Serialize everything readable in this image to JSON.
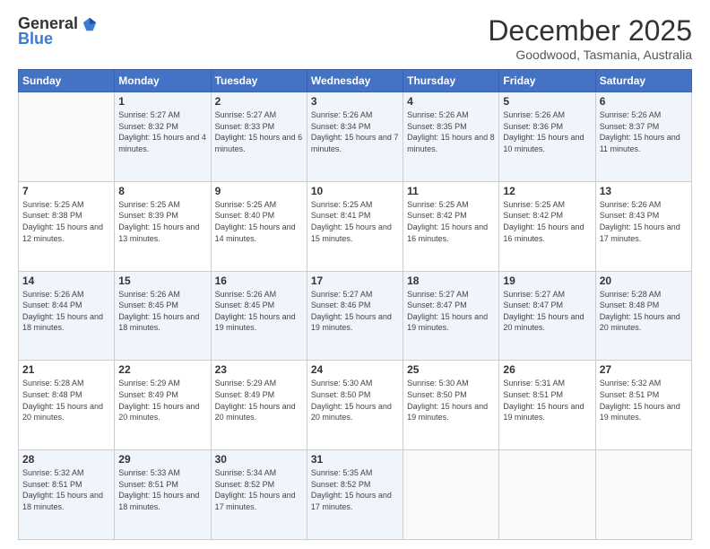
{
  "logo": {
    "general": "General",
    "blue": "Blue"
  },
  "header": {
    "month": "December 2025",
    "location": "Goodwood, Tasmania, Australia"
  },
  "weekdays": [
    "Sunday",
    "Monday",
    "Tuesday",
    "Wednesday",
    "Thursday",
    "Friday",
    "Saturday"
  ],
  "weeks": [
    [
      {
        "day": "",
        "sunrise": "",
        "sunset": "",
        "daylight": ""
      },
      {
        "day": "1",
        "sunrise": "Sunrise: 5:27 AM",
        "sunset": "Sunset: 8:32 PM",
        "daylight": "Daylight: 15 hours and 4 minutes."
      },
      {
        "day": "2",
        "sunrise": "Sunrise: 5:27 AM",
        "sunset": "Sunset: 8:33 PM",
        "daylight": "Daylight: 15 hours and 6 minutes."
      },
      {
        "day": "3",
        "sunrise": "Sunrise: 5:26 AM",
        "sunset": "Sunset: 8:34 PM",
        "daylight": "Daylight: 15 hours and 7 minutes."
      },
      {
        "day": "4",
        "sunrise": "Sunrise: 5:26 AM",
        "sunset": "Sunset: 8:35 PM",
        "daylight": "Daylight: 15 hours and 8 minutes."
      },
      {
        "day": "5",
        "sunrise": "Sunrise: 5:26 AM",
        "sunset": "Sunset: 8:36 PM",
        "daylight": "Daylight: 15 hours and 10 minutes."
      },
      {
        "day": "6",
        "sunrise": "Sunrise: 5:26 AM",
        "sunset": "Sunset: 8:37 PM",
        "daylight": "Daylight: 15 hours and 11 minutes."
      }
    ],
    [
      {
        "day": "7",
        "sunrise": "Sunrise: 5:25 AM",
        "sunset": "Sunset: 8:38 PM",
        "daylight": "Daylight: 15 hours and 12 minutes."
      },
      {
        "day": "8",
        "sunrise": "Sunrise: 5:25 AM",
        "sunset": "Sunset: 8:39 PM",
        "daylight": "Daylight: 15 hours and 13 minutes."
      },
      {
        "day": "9",
        "sunrise": "Sunrise: 5:25 AM",
        "sunset": "Sunset: 8:40 PM",
        "daylight": "Daylight: 15 hours and 14 minutes."
      },
      {
        "day": "10",
        "sunrise": "Sunrise: 5:25 AM",
        "sunset": "Sunset: 8:41 PM",
        "daylight": "Daylight: 15 hours and 15 minutes."
      },
      {
        "day": "11",
        "sunrise": "Sunrise: 5:25 AM",
        "sunset": "Sunset: 8:42 PM",
        "daylight": "Daylight: 15 hours and 16 minutes."
      },
      {
        "day": "12",
        "sunrise": "Sunrise: 5:25 AM",
        "sunset": "Sunset: 8:42 PM",
        "daylight": "Daylight: 15 hours and 16 minutes."
      },
      {
        "day": "13",
        "sunrise": "Sunrise: 5:26 AM",
        "sunset": "Sunset: 8:43 PM",
        "daylight": "Daylight: 15 hours and 17 minutes."
      }
    ],
    [
      {
        "day": "14",
        "sunrise": "Sunrise: 5:26 AM",
        "sunset": "Sunset: 8:44 PM",
        "daylight": "Daylight: 15 hours and 18 minutes."
      },
      {
        "day": "15",
        "sunrise": "Sunrise: 5:26 AM",
        "sunset": "Sunset: 8:45 PM",
        "daylight": "Daylight: 15 hours and 18 minutes."
      },
      {
        "day": "16",
        "sunrise": "Sunrise: 5:26 AM",
        "sunset": "Sunset: 8:45 PM",
        "daylight": "Daylight: 15 hours and 19 minutes."
      },
      {
        "day": "17",
        "sunrise": "Sunrise: 5:27 AM",
        "sunset": "Sunset: 8:46 PM",
        "daylight": "Daylight: 15 hours and 19 minutes."
      },
      {
        "day": "18",
        "sunrise": "Sunrise: 5:27 AM",
        "sunset": "Sunset: 8:47 PM",
        "daylight": "Daylight: 15 hours and 19 minutes."
      },
      {
        "day": "19",
        "sunrise": "Sunrise: 5:27 AM",
        "sunset": "Sunset: 8:47 PM",
        "daylight": "Daylight: 15 hours and 20 minutes."
      },
      {
        "day": "20",
        "sunrise": "Sunrise: 5:28 AM",
        "sunset": "Sunset: 8:48 PM",
        "daylight": "Daylight: 15 hours and 20 minutes."
      }
    ],
    [
      {
        "day": "21",
        "sunrise": "Sunrise: 5:28 AM",
        "sunset": "Sunset: 8:48 PM",
        "daylight": "Daylight: 15 hours and 20 minutes."
      },
      {
        "day": "22",
        "sunrise": "Sunrise: 5:29 AM",
        "sunset": "Sunset: 8:49 PM",
        "daylight": "Daylight: 15 hours and 20 minutes."
      },
      {
        "day": "23",
        "sunrise": "Sunrise: 5:29 AM",
        "sunset": "Sunset: 8:49 PM",
        "daylight": "Daylight: 15 hours and 20 minutes."
      },
      {
        "day": "24",
        "sunrise": "Sunrise: 5:30 AM",
        "sunset": "Sunset: 8:50 PM",
        "daylight": "Daylight: 15 hours and 20 minutes."
      },
      {
        "day": "25",
        "sunrise": "Sunrise: 5:30 AM",
        "sunset": "Sunset: 8:50 PM",
        "daylight": "Daylight: 15 hours and 19 minutes."
      },
      {
        "day": "26",
        "sunrise": "Sunrise: 5:31 AM",
        "sunset": "Sunset: 8:51 PM",
        "daylight": "Daylight: 15 hours and 19 minutes."
      },
      {
        "day": "27",
        "sunrise": "Sunrise: 5:32 AM",
        "sunset": "Sunset: 8:51 PM",
        "daylight": "Daylight: 15 hours and 19 minutes."
      }
    ],
    [
      {
        "day": "28",
        "sunrise": "Sunrise: 5:32 AM",
        "sunset": "Sunset: 8:51 PM",
        "daylight": "Daylight: 15 hours and 18 minutes."
      },
      {
        "day": "29",
        "sunrise": "Sunrise: 5:33 AM",
        "sunset": "Sunset: 8:51 PM",
        "daylight": "Daylight: 15 hours and 18 minutes."
      },
      {
        "day": "30",
        "sunrise": "Sunrise: 5:34 AM",
        "sunset": "Sunset: 8:52 PM",
        "daylight": "Daylight: 15 hours and 17 minutes."
      },
      {
        "day": "31",
        "sunrise": "Sunrise: 5:35 AM",
        "sunset": "Sunset: 8:52 PM",
        "daylight": "Daylight: 15 hours and 17 minutes."
      },
      {
        "day": "",
        "sunrise": "",
        "sunset": "",
        "daylight": ""
      },
      {
        "day": "",
        "sunrise": "",
        "sunset": "",
        "daylight": ""
      },
      {
        "day": "",
        "sunrise": "",
        "sunset": "",
        "daylight": ""
      }
    ]
  ]
}
